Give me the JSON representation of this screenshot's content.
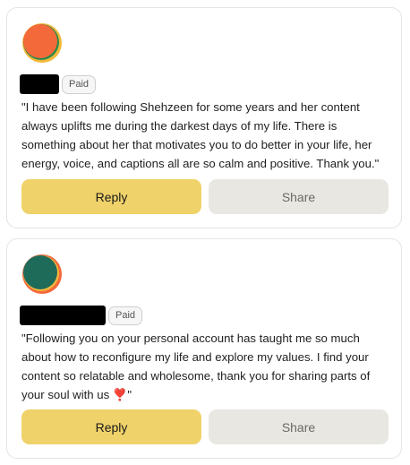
{
  "comments": [
    {
      "badge": "Paid",
      "text": "\"I have been following Shehzeen for some years and her content always uplifts me during the darkest days of my life. There is something about her that motivates you to do better in your life, her energy, voice, and captions all are so calm and positive. Thank you.\"",
      "reply_label": "Reply",
      "share_label": "Share"
    },
    {
      "badge": "Paid",
      "text": "\"Following you on your personal account has taught me so much about how to reconfigure my life and explore my values. I find your content so relatable and wholesome, thank you for sharing parts of your soul with us ",
      "emoji": "❣️",
      "text_end": "\"",
      "reply_label": "Reply",
      "share_label": "Share"
    }
  ],
  "colors": {
    "reply_bg": "#f0d26a",
    "share_bg": "#e8e7e2",
    "card_border": "#e4e4e4"
  }
}
